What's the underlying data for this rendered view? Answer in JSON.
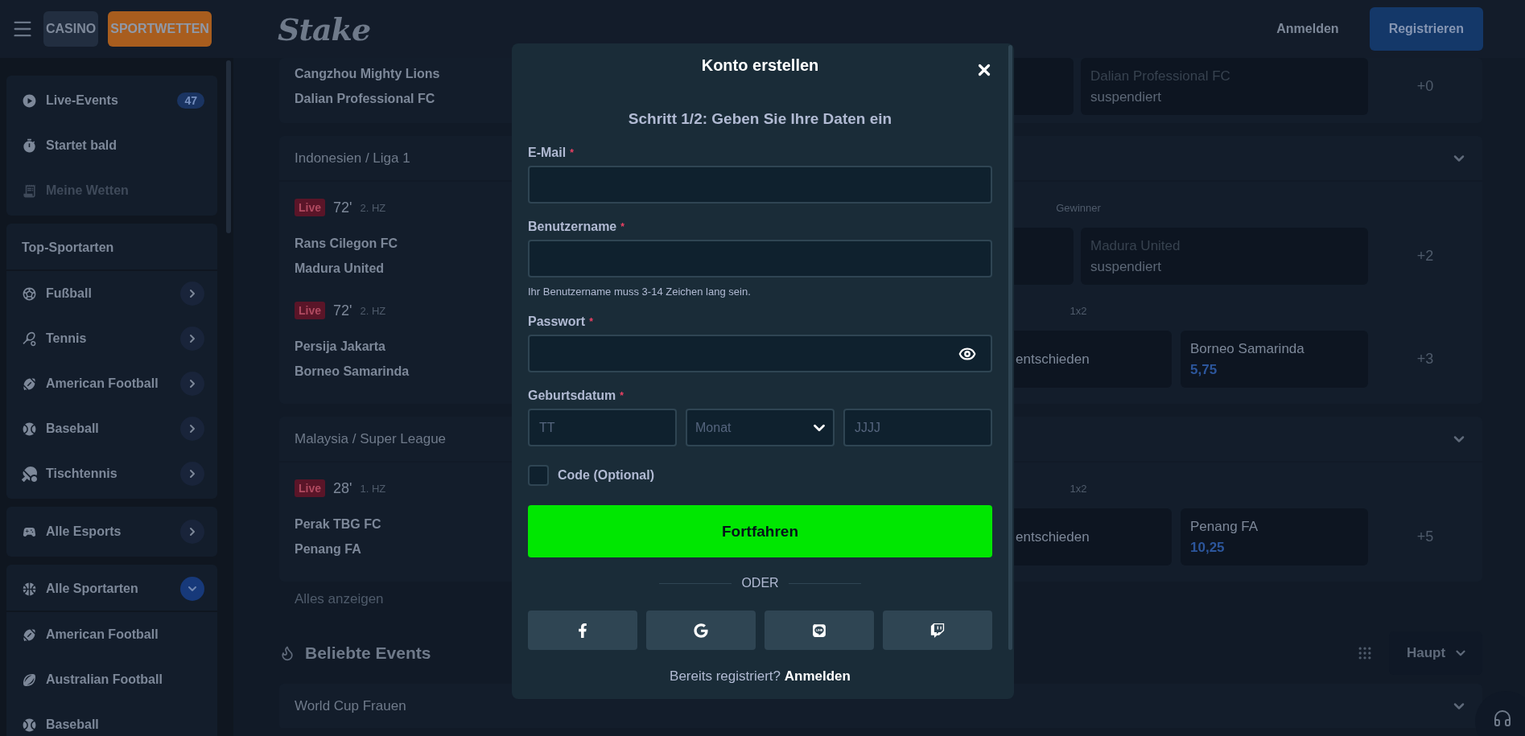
{
  "header": {
    "tabs": [
      {
        "label": "CASINO",
        "selected": false
      },
      {
        "label": "SPORTWETTEN",
        "selected": true
      }
    ],
    "logo": "Stake",
    "login": "Anmelden",
    "register": "Registrieren"
  },
  "sidebar": {
    "groups": [
      {
        "items": [
          {
            "label": "Live-Events",
            "kind": "live",
            "badge": "47",
            "disabled": false
          },
          {
            "label": "Startet bald",
            "kind": "soon",
            "disabled": false
          },
          {
            "label": "Meine Wetten",
            "kind": "bets",
            "disabled": true
          }
        ]
      },
      {
        "heading": "Top-Sportarten",
        "items": [
          {
            "label": "Fußball",
            "kind": "soccer",
            "expanded": false
          },
          {
            "label": "Tennis",
            "kind": "tennis",
            "expanded": false
          },
          {
            "label": "American Football",
            "kind": "american-football",
            "expanded": false
          },
          {
            "label": "Baseball",
            "kind": "baseball",
            "expanded": false
          },
          {
            "label": "Tischtennis",
            "kind": "table-tennis",
            "expanded": false
          }
        ]
      },
      {
        "items": [
          {
            "label": "Alle Esports",
            "kind": "esports",
            "expanded": false
          }
        ]
      },
      {
        "heading_item": {
          "label": "Alle Sportarten",
          "kind": "all-sports",
          "expanded": true
        },
        "items": [
          {
            "label": "American Football",
            "kind": "american-football"
          },
          {
            "label": "Australian Football",
            "kind": "australian-football"
          },
          {
            "label": "Baseball",
            "kind": "baseball"
          }
        ]
      }
    ]
  },
  "event_groups": [
    {
      "matches": [
        {
          "teams": [
            "Cangzhou Mighty Lions",
            "Dalian Professional FC"
          ],
          "kind": "two-way",
          "odds": [
            {
              "label": "Dalian Professional FC",
              "value": "suspendiert",
              "suspended": true
            }
          ],
          "more": "+0"
        }
      ]
    },
    {
      "league": "Indonesien / Liga 1",
      "matches": [
        {
          "live": "Live",
          "minute": "72'",
          "period": "2. HZ",
          "market": "Gewinner",
          "teams": [
            "Rans Cilegon FC",
            "Madura United"
          ],
          "kind": "two-way",
          "odds": [
            {
              "label": "Madura United",
              "value": "suspendiert",
              "suspended": true
            }
          ],
          "more": "+2"
        },
        {
          "live": "Live",
          "minute": "72'",
          "period": "2. HZ",
          "market": "1x2",
          "teams": [
            "Persija Jakarta",
            "Borneo Samarinda"
          ],
          "kind": "three-way",
          "odds": [
            {
              "label": "entschieden",
              "suspended": false
            },
            {
              "label": "Borneo Samarinda",
              "value": "5,75",
              "suspended": false
            }
          ],
          "more": "+3"
        }
      ]
    },
    {
      "league": "Malaysia / Super League",
      "matches": [
        {
          "live": "Live",
          "minute": "28'",
          "period": "1. HZ",
          "market": "1x2",
          "teams": [
            "Perak TBG FC",
            "Penang FA"
          ],
          "kind": "three-way",
          "odds": [
            {
              "label": "entschieden",
              "suspended": false
            },
            {
              "label": "Penang FA",
              "value": "10,25",
              "suspended": false
            }
          ],
          "more": "+5"
        }
      ]
    }
  ],
  "show_all": "Alles anzeigen",
  "popular": {
    "title": "Beliebte Events",
    "view": "Haupt",
    "leagues": [
      "World Cup Frauen"
    ]
  },
  "dialog": {
    "title": "Konto erstellen",
    "step": "Schritt 1/2: Geben Sie Ihre Daten ein",
    "fields": [
      {
        "label": "E-Mail",
        "required_mark": "*",
        "kind": "text"
      },
      {
        "label": "Benutzername",
        "required_mark": "*",
        "kind": "text",
        "hint": "Ihr Benutzername muss 3-14 Zeichen lang sein."
      },
      {
        "label": "Passwort",
        "required_mark": "*",
        "kind": "password"
      },
      {
        "label": "Geburtsdatum",
        "required_mark": "*",
        "kind": "date",
        "parts": [
          {
            "placeholder": "TT",
            "kind": "input"
          },
          {
            "placeholder": "Monat",
            "kind": "select"
          },
          {
            "placeholder": "JJJJ",
            "kind": "input"
          }
        ]
      }
    ],
    "code": {
      "label": "Code (Optional)",
      "checked": false
    },
    "submit": "Fortfahren",
    "divider": "ODER",
    "social": [
      {
        "kind": "facebook"
      },
      {
        "kind": "google"
      },
      {
        "kind": "line"
      },
      {
        "kind": "twitch"
      }
    ],
    "footer": {
      "text": "Bereits registriert?",
      "link": "Anmelden"
    }
  }
}
